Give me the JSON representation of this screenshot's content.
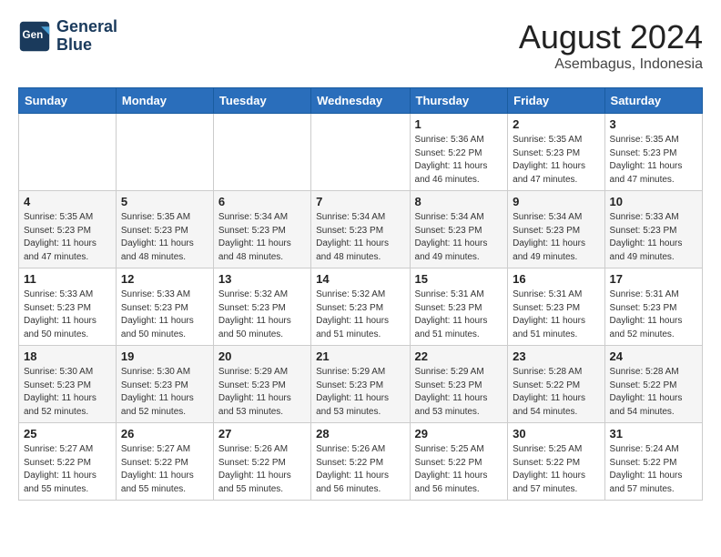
{
  "header": {
    "logo_line1": "General",
    "logo_line2": "Blue",
    "main_title": "August 2024",
    "subtitle": "Asembagus, Indonesia"
  },
  "weekdays": [
    "Sunday",
    "Monday",
    "Tuesday",
    "Wednesday",
    "Thursday",
    "Friday",
    "Saturday"
  ],
  "weeks": [
    [
      {
        "day": "",
        "info": ""
      },
      {
        "day": "",
        "info": ""
      },
      {
        "day": "",
        "info": ""
      },
      {
        "day": "",
        "info": ""
      },
      {
        "day": "1",
        "info": "Sunrise: 5:36 AM\nSunset: 5:22 PM\nDaylight: 11 hours\nand 46 minutes."
      },
      {
        "day": "2",
        "info": "Sunrise: 5:35 AM\nSunset: 5:23 PM\nDaylight: 11 hours\nand 47 minutes."
      },
      {
        "day": "3",
        "info": "Sunrise: 5:35 AM\nSunset: 5:23 PM\nDaylight: 11 hours\nand 47 minutes."
      }
    ],
    [
      {
        "day": "4",
        "info": "Sunrise: 5:35 AM\nSunset: 5:23 PM\nDaylight: 11 hours\nand 47 minutes."
      },
      {
        "day": "5",
        "info": "Sunrise: 5:35 AM\nSunset: 5:23 PM\nDaylight: 11 hours\nand 48 minutes."
      },
      {
        "day": "6",
        "info": "Sunrise: 5:34 AM\nSunset: 5:23 PM\nDaylight: 11 hours\nand 48 minutes."
      },
      {
        "day": "7",
        "info": "Sunrise: 5:34 AM\nSunset: 5:23 PM\nDaylight: 11 hours\nand 48 minutes."
      },
      {
        "day": "8",
        "info": "Sunrise: 5:34 AM\nSunset: 5:23 PM\nDaylight: 11 hours\nand 49 minutes."
      },
      {
        "day": "9",
        "info": "Sunrise: 5:34 AM\nSunset: 5:23 PM\nDaylight: 11 hours\nand 49 minutes."
      },
      {
        "day": "10",
        "info": "Sunrise: 5:33 AM\nSunset: 5:23 PM\nDaylight: 11 hours\nand 49 minutes."
      }
    ],
    [
      {
        "day": "11",
        "info": "Sunrise: 5:33 AM\nSunset: 5:23 PM\nDaylight: 11 hours\nand 50 minutes."
      },
      {
        "day": "12",
        "info": "Sunrise: 5:33 AM\nSunset: 5:23 PM\nDaylight: 11 hours\nand 50 minutes."
      },
      {
        "day": "13",
        "info": "Sunrise: 5:32 AM\nSunset: 5:23 PM\nDaylight: 11 hours\nand 50 minutes."
      },
      {
        "day": "14",
        "info": "Sunrise: 5:32 AM\nSunset: 5:23 PM\nDaylight: 11 hours\nand 51 minutes."
      },
      {
        "day": "15",
        "info": "Sunrise: 5:31 AM\nSunset: 5:23 PM\nDaylight: 11 hours\nand 51 minutes."
      },
      {
        "day": "16",
        "info": "Sunrise: 5:31 AM\nSunset: 5:23 PM\nDaylight: 11 hours\nand 51 minutes."
      },
      {
        "day": "17",
        "info": "Sunrise: 5:31 AM\nSunset: 5:23 PM\nDaylight: 11 hours\nand 52 minutes."
      }
    ],
    [
      {
        "day": "18",
        "info": "Sunrise: 5:30 AM\nSunset: 5:23 PM\nDaylight: 11 hours\nand 52 minutes."
      },
      {
        "day": "19",
        "info": "Sunrise: 5:30 AM\nSunset: 5:23 PM\nDaylight: 11 hours\nand 52 minutes."
      },
      {
        "day": "20",
        "info": "Sunrise: 5:29 AM\nSunset: 5:23 PM\nDaylight: 11 hours\nand 53 minutes."
      },
      {
        "day": "21",
        "info": "Sunrise: 5:29 AM\nSunset: 5:23 PM\nDaylight: 11 hours\nand 53 minutes."
      },
      {
        "day": "22",
        "info": "Sunrise: 5:29 AM\nSunset: 5:23 PM\nDaylight: 11 hours\nand 53 minutes."
      },
      {
        "day": "23",
        "info": "Sunrise: 5:28 AM\nSunset: 5:22 PM\nDaylight: 11 hours\nand 54 minutes."
      },
      {
        "day": "24",
        "info": "Sunrise: 5:28 AM\nSunset: 5:22 PM\nDaylight: 11 hours\nand 54 minutes."
      }
    ],
    [
      {
        "day": "25",
        "info": "Sunrise: 5:27 AM\nSunset: 5:22 PM\nDaylight: 11 hours\nand 55 minutes."
      },
      {
        "day": "26",
        "info": "Sunrise: 5:27 AM\nSunset: 5:22 PM\nDaylight: 11 hours\nand 55 minutes."
      },
      {
        "day": "27",
        "info": "Sunrise: 5:26 AM\nSunset: 5:22 PM\nDaylight: 11 hours\nand 55 minutes."
      },
      {
        "day": "28",
        "info": "Sunrise: 5:26 AM\nSunset: 5:22 PM\nDaylight: 11 hours\nand 56 minutes."
      },
      {
        "day": "29",
        "info": "Sunrise: 5:25 AM\nSunset: 5:22 PM\nDaylight: 11 hours\nand 56 minutes."
      },
      {
        "day": "30",
        "info": "Sunrise: 5:25 AM\nSunset: 5:22 PM\nDaylight: 11 hours\nand 57 minutes."
      },
      {
        "day": "31",
        "info": "Sunrise: 5:24 AM\nSunset: 5:22 PM\nDaylight: 11 hours\nand 57 minutes."
      }
    ]
  ]
}
